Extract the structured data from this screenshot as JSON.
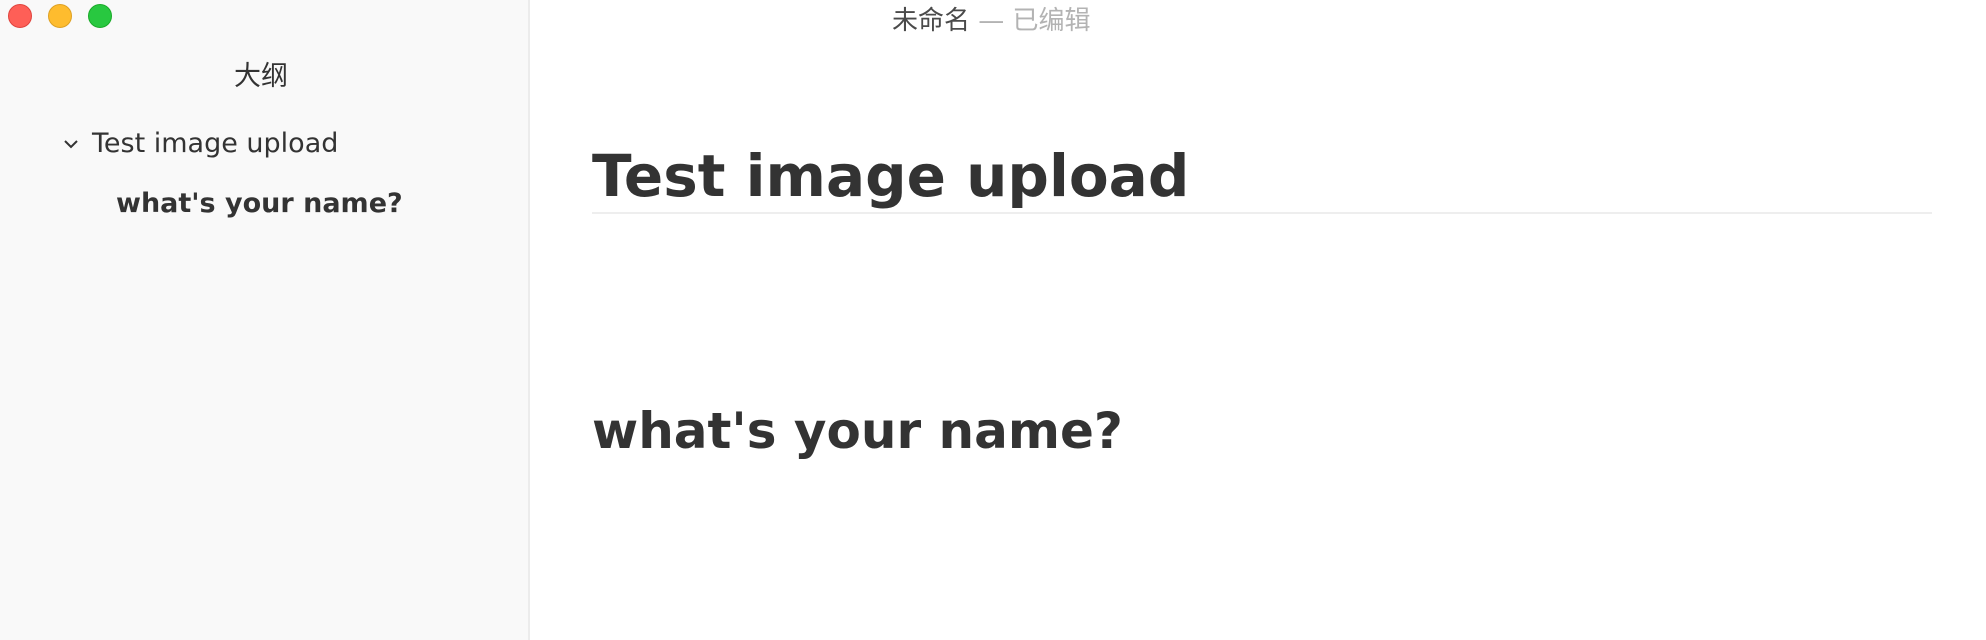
{
  "window": {
    "title": "未命名",
    "separator": "—",
    "status": "已编辑"
  },
  "sidebar": {
    "title": "大纲",
    "items": [
      {
        "label": "Test image upload",
        "expanded": true
      },
      {
        "label": "what's your name?"
      }
    ]
  },
  "document": {
    "heading1": "Test image upload",
    "heading2": "what's your name?"
  },
  "colors": {
    "close": "#fe5f57",
    "minimize": "#febc2e",
    "maximize": "#28c840",
    "text": "#333333",
    "muted": "#b3b3b3",
    "sidebar_bg": "#f9f9f9"
  }
}
